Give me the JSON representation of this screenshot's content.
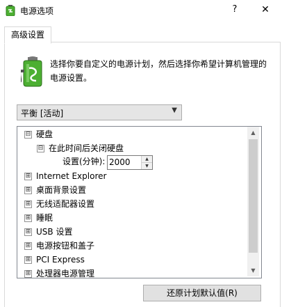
{
  "window": {
    "title": "电源选项",
    "help_label": "?",
    "close_label": "✕"
  },
  "tabs": [
    {
      "label": "高级设置",
      "selected": true
    }
  ],
  "description": "选择你要自定义的电源计划，然后选择你希望计算机管理的电源设置。",
  "plan_select": {
    "value": "平衡 [活动]"
  },
  "tree": {
    "items": [
      {
        "label": "硬盘",
        "expander": "⊟"
      },
      {
        "label": "在此时间后关闭硬盘",
        "expander": "⊟"
      },
      {
        "label": "Internet Explorer",
        "expander": "⊞"
      },
      {
        "label": "桌面背景设置",
        "expander": "⊞"
      },
      {
        "label": "无线适配器设置",
        "expander": "⊞"
      },
      {
        "label": "睡眠",
        "expander": "⊞"
      },
      {
        "label": "USB 设置",
        "expander": "⊞"
      },
      {
        "label": "电源按钮和盖子",
        "expander": "⊞"
      },
      {
        "label": "PCI Express",
        "expander": "⊞"
      },
      {
        "label": "处理器电源管理",
        "expander": "⊞"
      }
    ],
    "setting": {
      "label": "设置(分钟):",
      "value": "2000"
    }
  },
  "buttons": {
    "restore_defaults": "还原计划默认值(R)"
  },
  "icons": {
    "app": "power-options-icon",
    "battery": "battery-plan-icon",
    "dropdown": "chevron-down-icon",
    "spin_up": "spin-up-icon",
    "spin_down": "spin-down-icon"
  },
  "colors": {
    "battery_green": "#4caf32",
    "scroll_thumb": "#cdcdcd"
  }
}
